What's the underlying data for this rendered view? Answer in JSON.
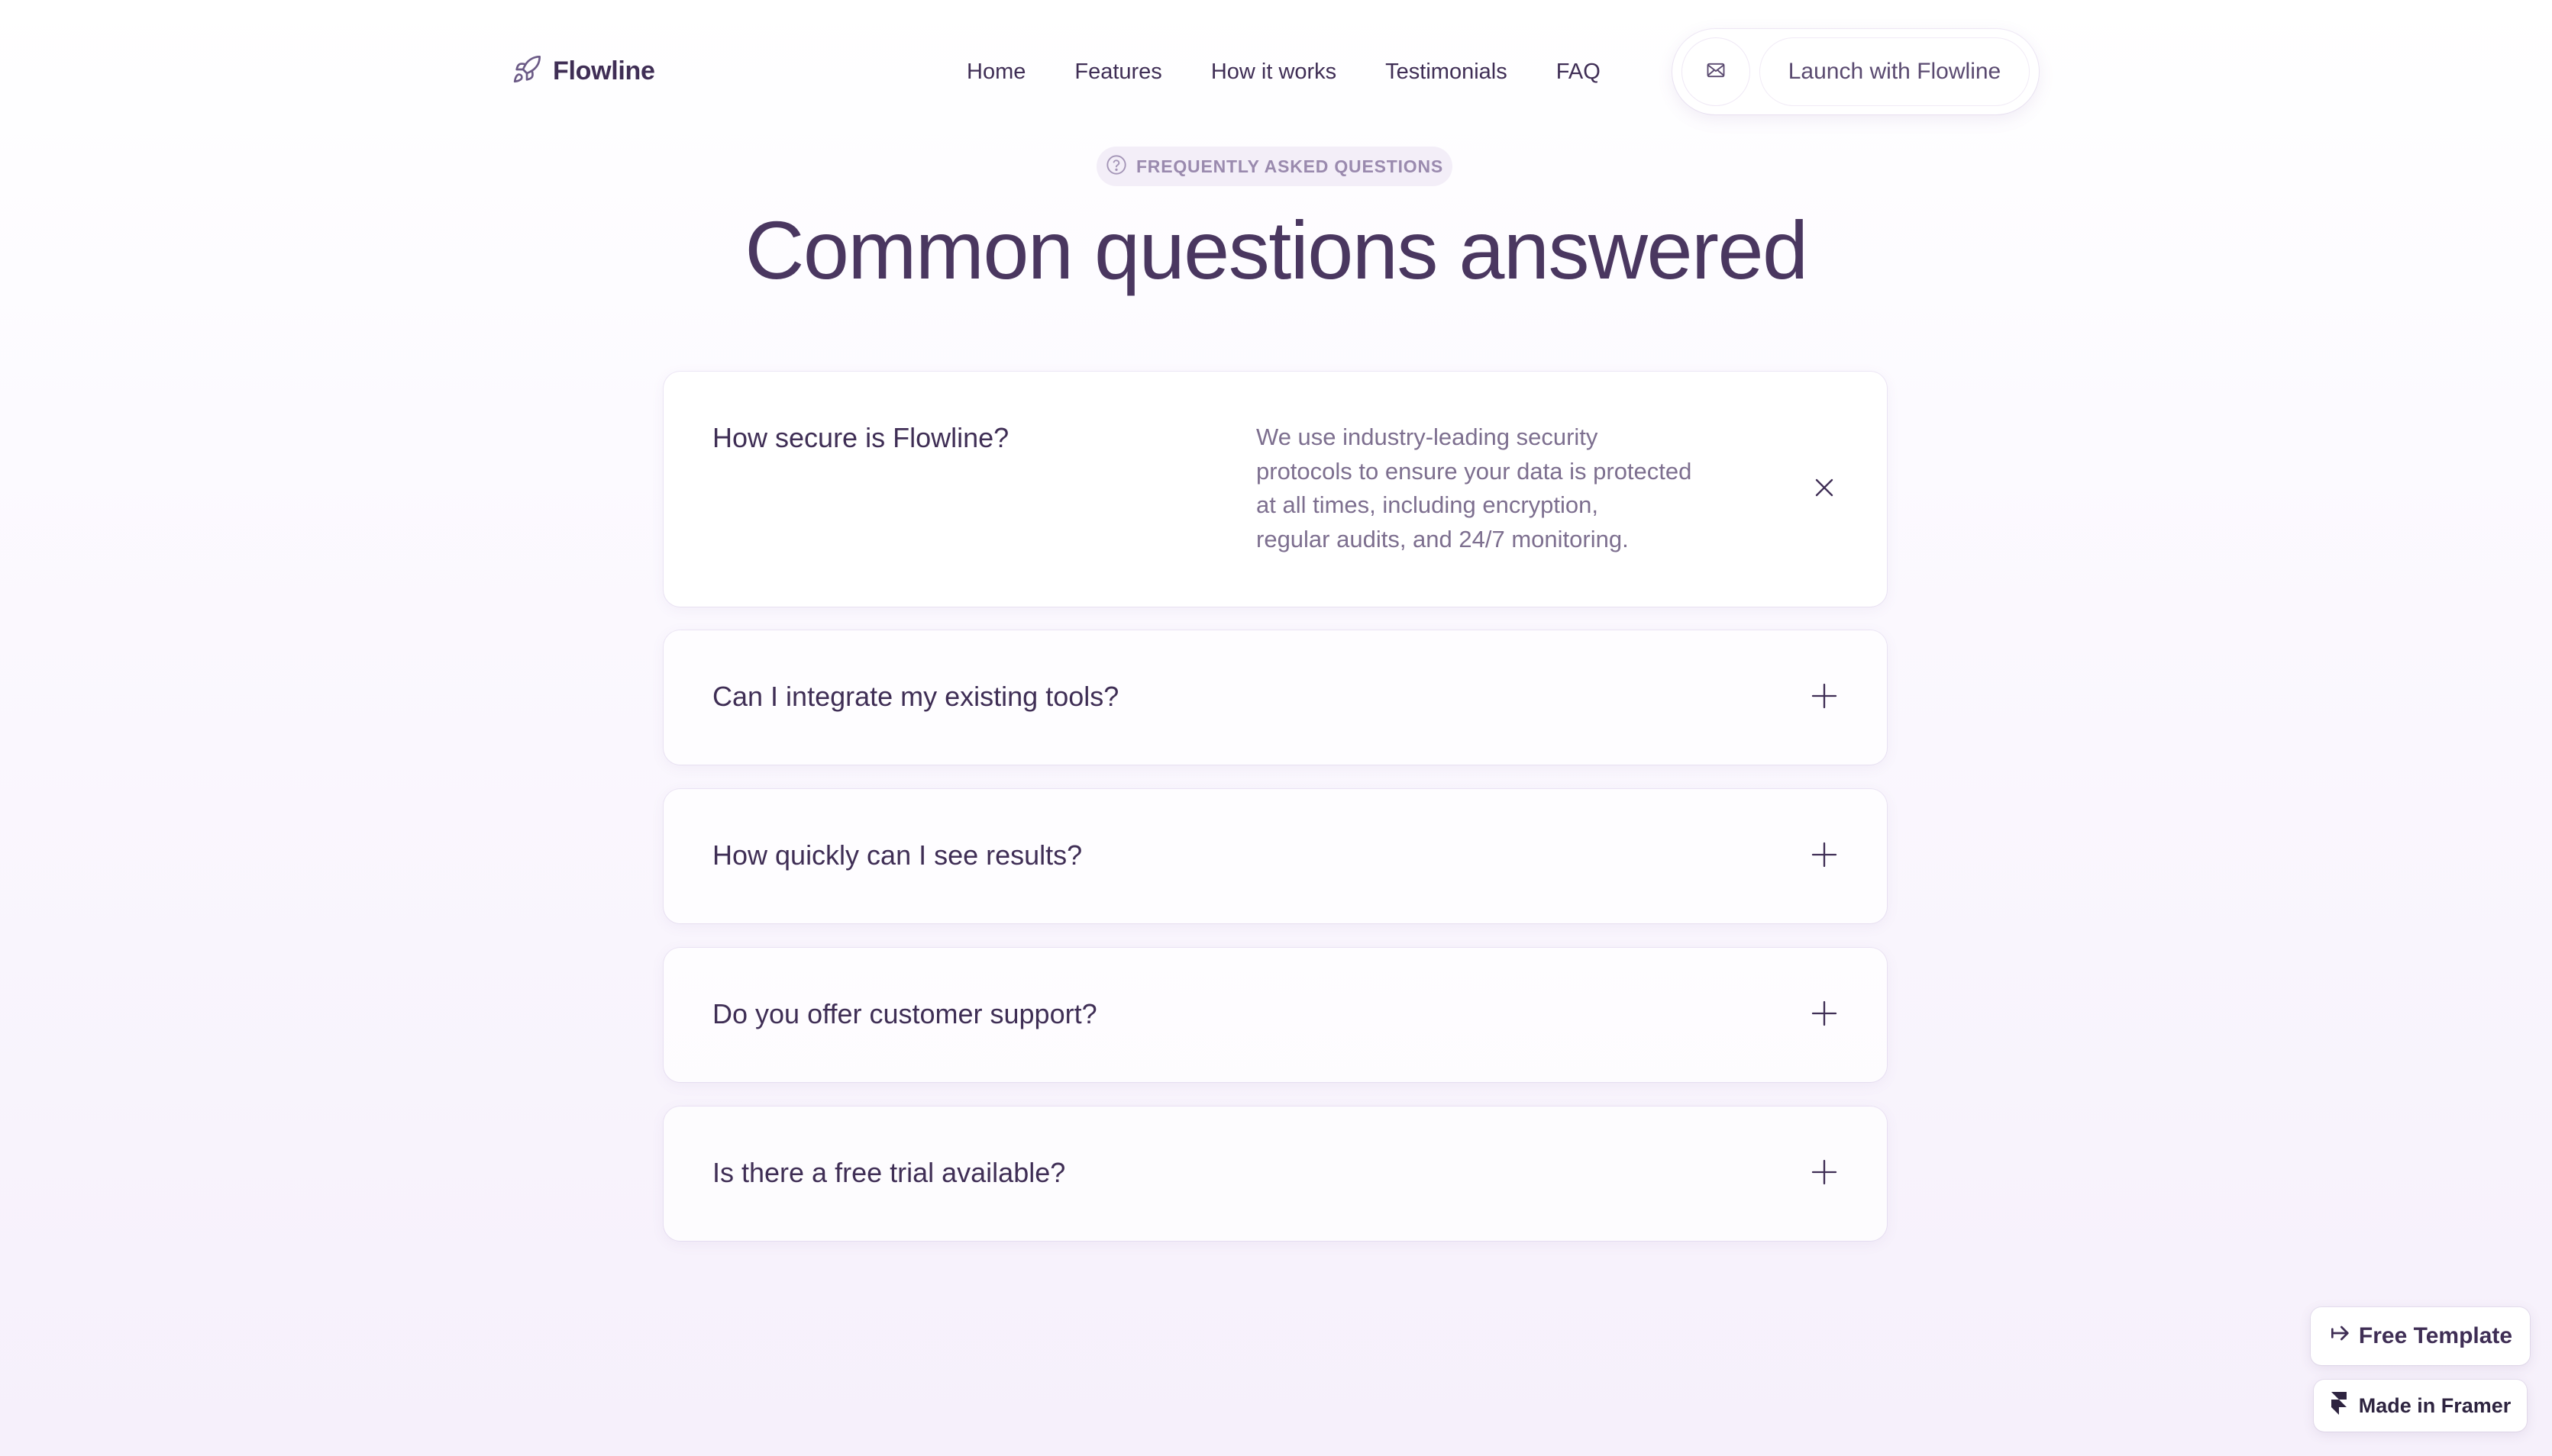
{
  "brand": {
    "name": "Flowline",
    "icon": "rocket-icon"
  },
  "nav": {
    "links": [
      "Home",
      "Features",
      "How it works",
      "Testimonials",
      "FAQ"
    ],
    "mail_icon": "mail-icon",
    "cta_label": "Launch with Flowline"
  },
  "header": {
    "badge_icon": "question-circle-icon",
    "badge_label": "FREQUENTLY ASKED QUESTIONS",
    "title": "Common questions answered"
  },
  "faq": {
    "items": [
      {
        "question": "How secure is Flowline?",
        "answer_lines": [
          "We use industry-leading security",
          "protocols to ensure your data is protected",
          "at all times, including encryption,",
          "regular audits, and 24/7 monitoring."
        ],
        "expanded": true,
        "toggle_icon": "close-icon"
      },
      {
        "question": "Can I integrate my existing tools?",
        "expanded": false,
        "toggle_icon": "plus-icon"
      },
      {
        "question": "How quickly can I see results?",
        "expanded": false,
        "toggle_icon": "plus-icon"
      },
      {
        "question": "Do you offer customer support?",
        "expanded": false,
        "toggle_icon": "plus-icon"
      },
      {
        "question": "Is there a free trial available?",
        "expanded": false,
        "toggle_icon": "plus-icon"
      }
    ]
  },
  "footer_badges": {
    "free_template": "Free Template",
    "free_template_icon": "arrow-right-icon",
    "made_in_framer": "Made in Framer",
    "framer_icon": "framer-logo-icon"
  },
  "colors": {
    "text_primary": "#3f2e55",
    "text_muted": "#7d6f8f",
    "badge_bg": "#f3eef8",
    "badge_text": "#9a8aae"
  }
}
